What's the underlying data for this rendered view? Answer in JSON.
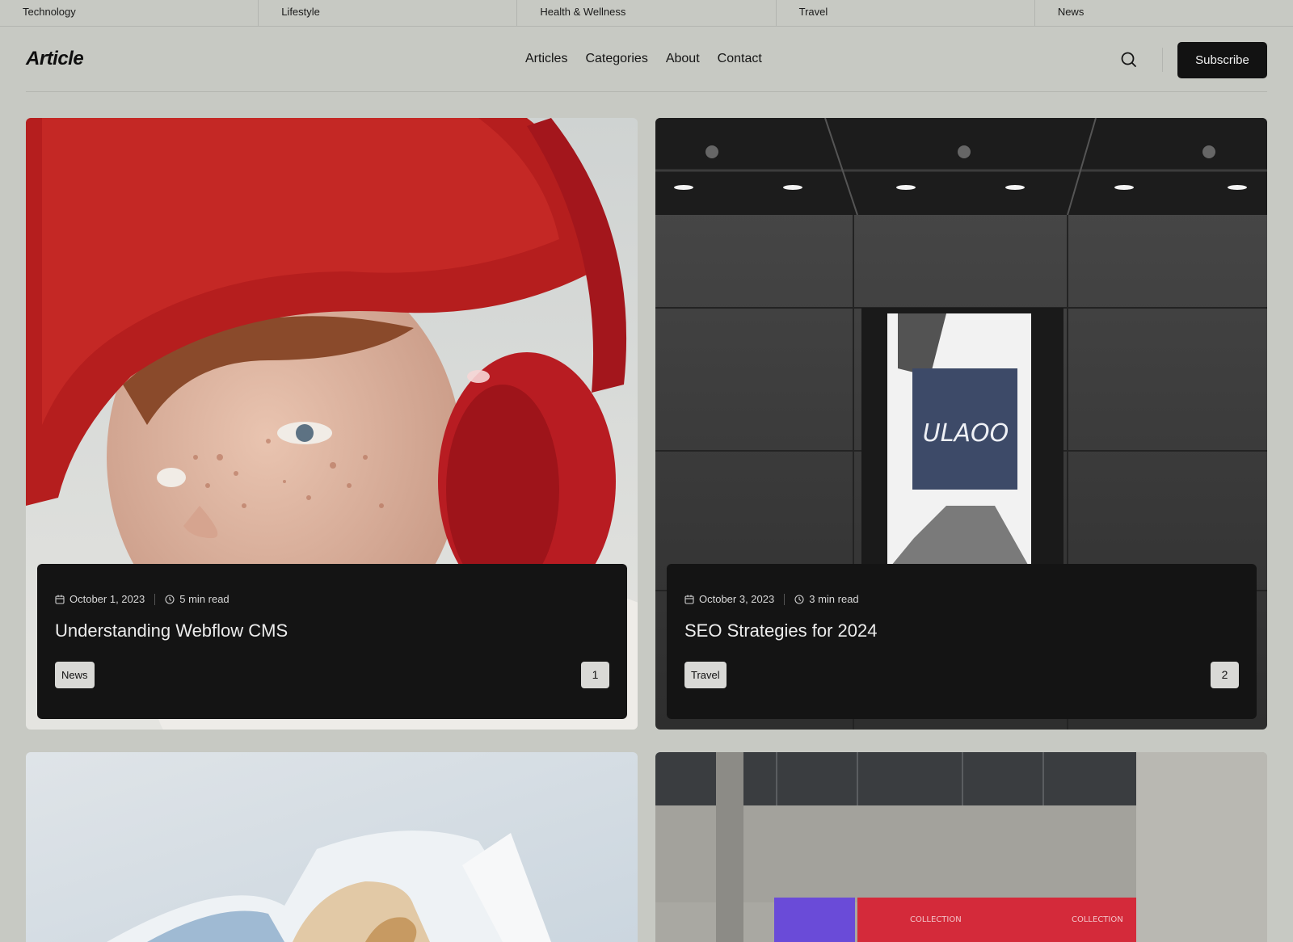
{
  "categories": [
    "Technology",
    "Lifestyle",
    "Health & Wellness",
    "Travel",
    "News"
  ],
  "header": {
    "logo": "Article",
    "nav": [
      "Articles",
      "Categories",
      "About",
      "Contact"
    ],
    "subscribe_label": "Subscribe",
    "search_icon": "search-icon"
  },
  "articles": [
    {
      "date": "October 1, 2023",
      "read_time": "5 min read",
      "title": "Understanding Webflow CMS",
      "tag": "News",
      "number": "1"
    },
    {
      "date": "October 3, 2023",
      "read_time": "3 min read",
      "title": "SEO Strategies for 2024",
      "tag": "Travel",
      "number": "2"
    }
  ],
  "colors": {
    "background": "#c7c9c3",
    "dark": "#121212",
    "tag_bg": "#d9d9d6"
  }
}
